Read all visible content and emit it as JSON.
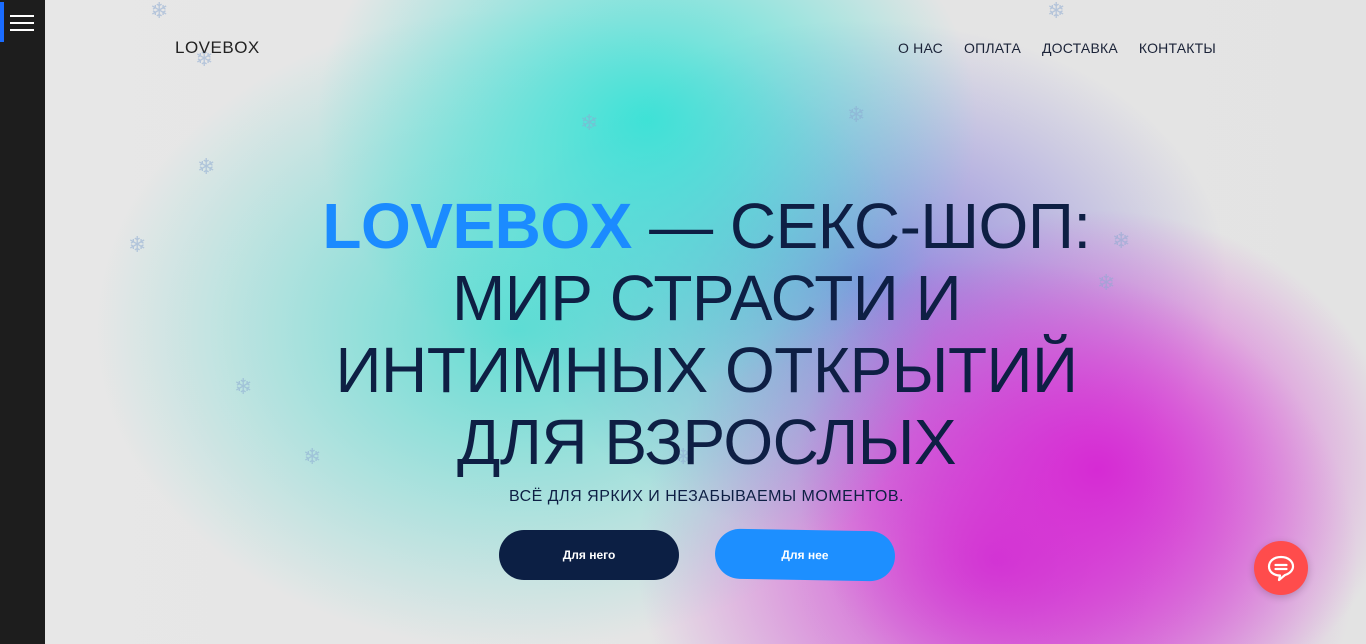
{
  "sidebar": {
    "menu_icon": "hamburger-menu-icon"
  },
  "header": {
    "logo": "LOVEBOX",
    "nav": [
      "О НАС",
      "ОПЛАТА",
      "ДОСТАВКА",
      "КОНТАКТЫ"
    ]
  },
  "hero": {
    "headline_brand": "LOVEBOX",
    "headline_line1_rest": " — СЕКС-ШОП:",
    "headline_line2": "МИР СТРАСТИ И",
    "headline_line3": "ИНТИМНЫХ ОТКРЫТИЙ",
    "headline_line4": "ДЛЯ ВЗРОСЛЫХ",
    "subtitle": "ВСЁ ДЛЯ ЯРКИХ И НЕЗАБЫВАЕМЫ МОМЕНТОВ.",
    "button_him": "Для него",
    "button_her": "Для нее"
  },
  "chat_widget": {
    "icon": "chat-bubble-icon",
    "color": "#ff4c4c"
  },
  "colors": {
    "accent": "#1b8bff",
    "dark": "#0c1f44",
    "sidebar": "#1d1d1d"
  }
}
